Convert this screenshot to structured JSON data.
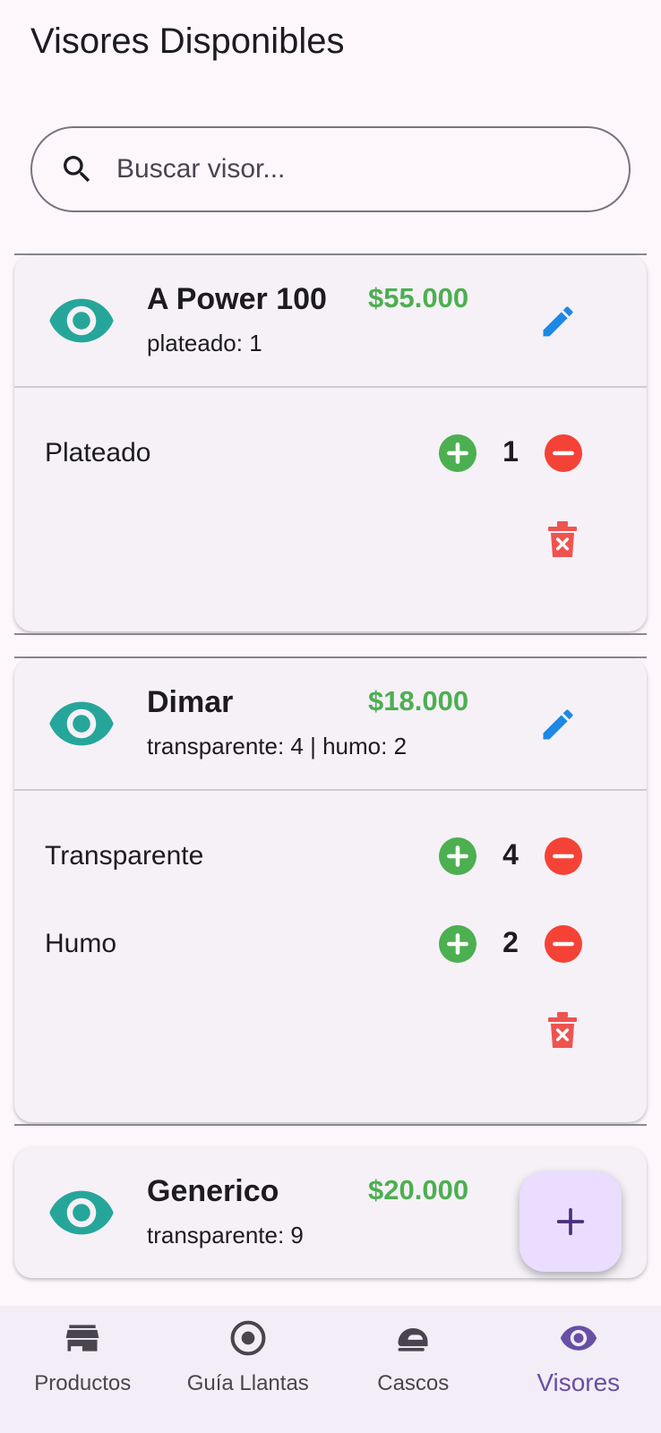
{
  "header": {
    "title": "Visores Disponibles"
  },
  "search": {
    "placeholder": "Buscar visor...",
    "icon": "search-icon"
  },
  "colors": {
    "price": "#4caf50",
    "eye": "#26a69a",
    "edit": "#1e88e5",
    "plus": "#4caf50",
    "minus": "#f44336",
    "trash": "#ef5350",
    "fab_bg": "#eaddff",
    "active_nav": "#6750a4"
  },
  "visors": [
    {
      "name": "A Power 100",
      "price": "$55.000",
      "summary": "plateado: 1",
      "variants": [
        {
          "label": "Plateado",
          "qty": "1"
        }
      ]
    },
    {
      "name": "Dimar",
      "price": "$18.000",
      "summary": "transparente: 4 | humo: 2",
      "variants": [
        {
          "label": "Transparente",
          "qty": "4"
        },
        {
          "label": "Humo",
          "qty": "2"
        }
      ]
    },
    {
      "name": "Generico",
      "price": "$20.000",
      "summary": "transparente: 9",
      "variants": []
    }
  ],
  "fab": {
    "icon": "plus-icon"
  },
  "nav": [
    {
      "label": "Productos",
      "icon": "store-icon",
      "active": false
    },
    {
      "label": "Guía Llantas",
      "icon": "tire-icon",
      "active": false
    },
    {
      "label": "Cascos",
      "icon": "helmet-icon",
      "active": false
    },
    {
      "label": "Visores",
      "icon": "eye-icon",
      "active": true
    }
  ]
}
